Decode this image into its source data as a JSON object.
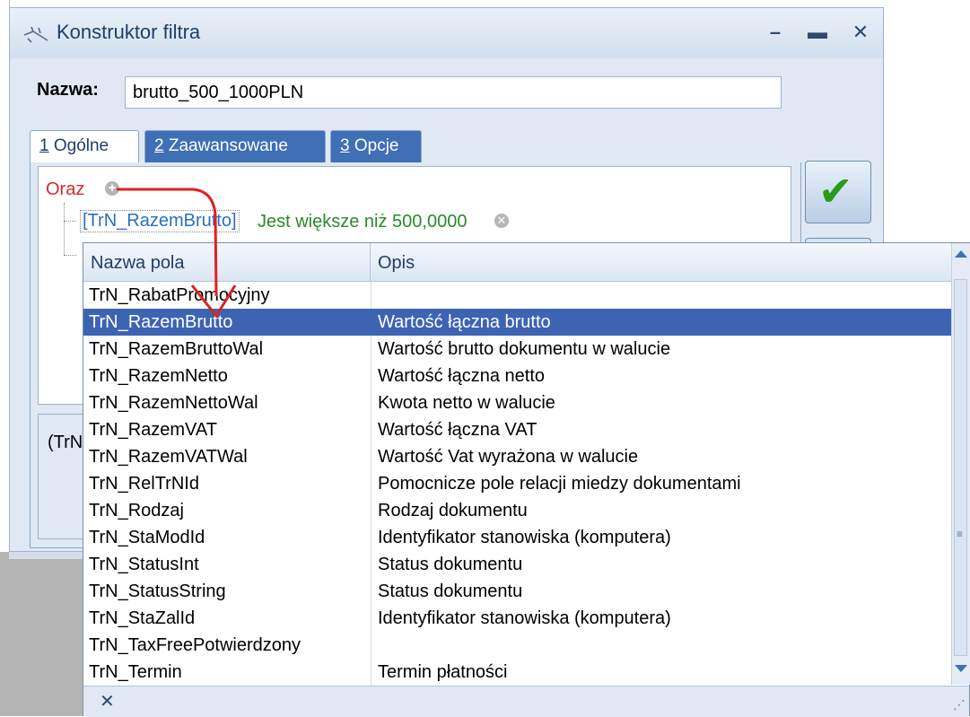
{
  "dialog": {
    "title": "Konstruktor filtra",
    "window_buttons": {
      "minimize": "–",
      "maximize": "▬",
      "close": "✕"
    },
    "name_label": "Nazwa:",
    "name_value": "brutto_500_1000PLN",
    "tabs": [
      {
        "num": "1",
        "label": " Ogólne"
      },
      {
        "num": "2",
        "label": " Zaawansowane"
      },
      {
        "num": "3",
        "label": " Opcje"
      }
    ],
    "filter": {
      "group_operator": "Oraz",
      "condition_field": "[TrN_RazemBrutto]",
      "condition_operator": "Jest większe niż 500,0000"
    },
    "expression_preview": "(TrN",
    "ok_icon": "checkmark-icon"
  },
  "popup": {
    "columns": {
      "name": "Nazwa pola",
      "desc": "Opis"
    },
    "rows": [
      {
        "name": "TrN_RabatPromocyjny",
        "desc": ""
      },
      {
        "name": "TrN_RazemBrutto",
        "desc": "Wartość łączna brutto",
        "selected": true
      },
      {
        "name": "TrN_RazemBruttoWal",
        "desc": "Wartość brutto dokumentu w walucie"
      },
      {
        "name": "TrN_RazemNetto",
        "desc": "Wartość łączna netto"
      },
      {
        "name": "TrN_RazemNettoWal",
        "desc": "Kwota netto w walucie"
      },
      {
        "name": "TrN_RazemVAT",
        "desc": "Wartość łączna VAT"
      },
      {
        "name": "TrN_RazemVATWal",
        "desc": "Wartość Vat wyrażona w walucie"
      },
      {
        "name": "TrN_RelTrNId",
        "desc": "Pomocnicze pole relacji miedzy dokumentami"
      },
      {
        "name": "TrN_Rodzaj",
        "desc": "Rodzaj dokumentu"
      },
      {
        "name": "TrN_StaModId",
        "desc": "Identyfikator stanowiska (komputera)"
      },
      {
        "name": "TrN_StatusInt",
        "desc": "Status dokumentu"
      },
      {
        "name": "TrN_StatusString",
        "desc": "Status dokumentu"
      },
      {
        "name": "TrN_StaZalId",
        "desc": "Identyfikator stanowiska (komputera)"
      },
      {
        "name": "TrN_TaxFreePotwierdzony",
        "desc": ""
      },
      {
        "name": "TrN_Termin",
        "desc": "Termin płatności"
      }
    ],
    "footer_close": "✕",
    "resize_grip": "⋰"
  },
  "colors": {
    "selection": "#3c64b2",
    "annotation_arrow": "#e02020",
    "operator_text": "#d42a2a",
    "condition_op_text": "#2a8a2a",
    "field_text": "#2a6fc4"
  }
}
